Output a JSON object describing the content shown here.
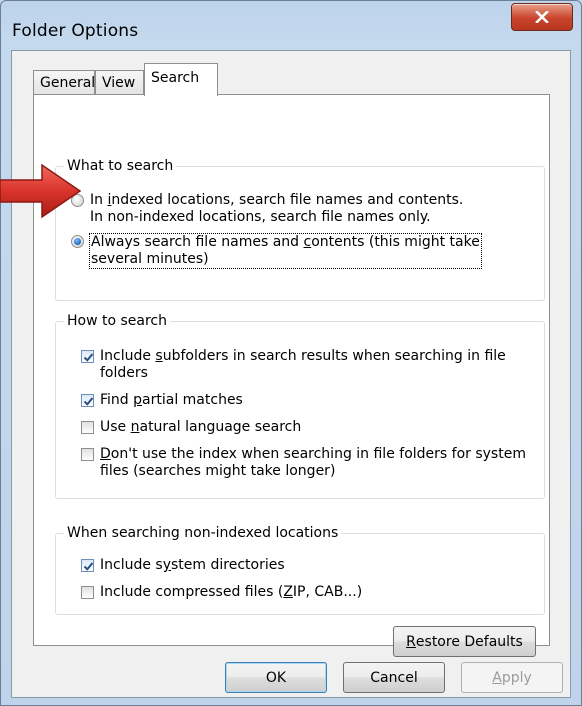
{
  "window": {
    "title": "Folder Options",
    "close_symbol": "X"
  },
  "tabs": [
    {
      "label": "General",
      "active": false
    },
    {
      "label": "View",
      "active": false
    },
    {
      "label": "Search",
      "active": true
    }
  ],
  "what_to_search": {
    "title": "What to search",
    "option1_line1_pre": "In ",
    "option1_line1_u": "i",
    "option1_line1_post": "ndexed locations, search file names and contents.",
    "option1_line2": "In non-indexed locations, search file names only.",
    "option2_line1_pre": "Always search file names and ",
    "option2_line1_u": "c",
    "option2_line1_post": "ontents (this might take",
    "option2_line2": "several minutes)",
    "selected": 2
  },
  "how_to_search": {
    "title": "How to search",
    "opt1_pre": "Include ",
    "opt1_u": "s",
    "opt1_post": "ubfolders in search results when searching in file",
    "opt1_line2": "folders",
    "opt1_checked": true,
    "opt2_pre": "Find ",
    "opt2_u": "p",
    "opt2_post": "artial matches",
    "opt2_checked": true,
    "opt3_pre": "Use ",
    "opt3_u": "n",
    "opt3_post": "atural language search",
    "opt3_checked": false,
    "opt4_u": "D",
    "opt4_post": "on't use the index when searching in file folders for system",
    "opt4_line2": "files (searches might take longer)",
    "opt4_checked": false
  },
  "non_indexed": {
    "title": "When searching non-indexed locations",
    "opt1_pre": "Include s",
    "opt1_u": "y",
    "opt1_post": "stem directories",
    "opt1_checked": true,
    "opt2_pre": "Include compressed files (",
    "opt2_u": "Z",
    "opt2_post": "IP, CAB...)",
    "opt2_checked": false
  },
  "buttons": {
    "restore_u": "R",
    "restore_post": "estore Defaults",
    "ok": "OK",
    "cancel": "Cancel",
    "apply_u": "A",
    "apply_post": "pply"
  },
  "colors": {
    "arrow": "#d9342b",
    "accent_blue": "#1d5fb8"
  }
}
